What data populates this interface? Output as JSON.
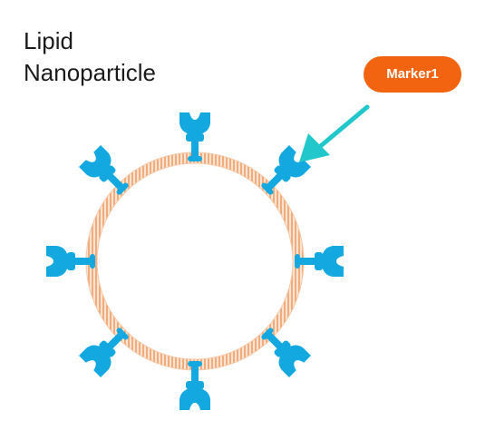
{
  "title": {
    "line1": "Lipid",
    "line2": "Nanoparticle"
  },
  "marker": {
    "label": "Marker1",
    "color": "#f2640f",
    "arrow_color": "#22c7cc"
  },
  "diagram": {
    "membrane_color": "#f2b98e",
    "protein_color": "#13a9e0",
    "protein_count": 8
  }
}
